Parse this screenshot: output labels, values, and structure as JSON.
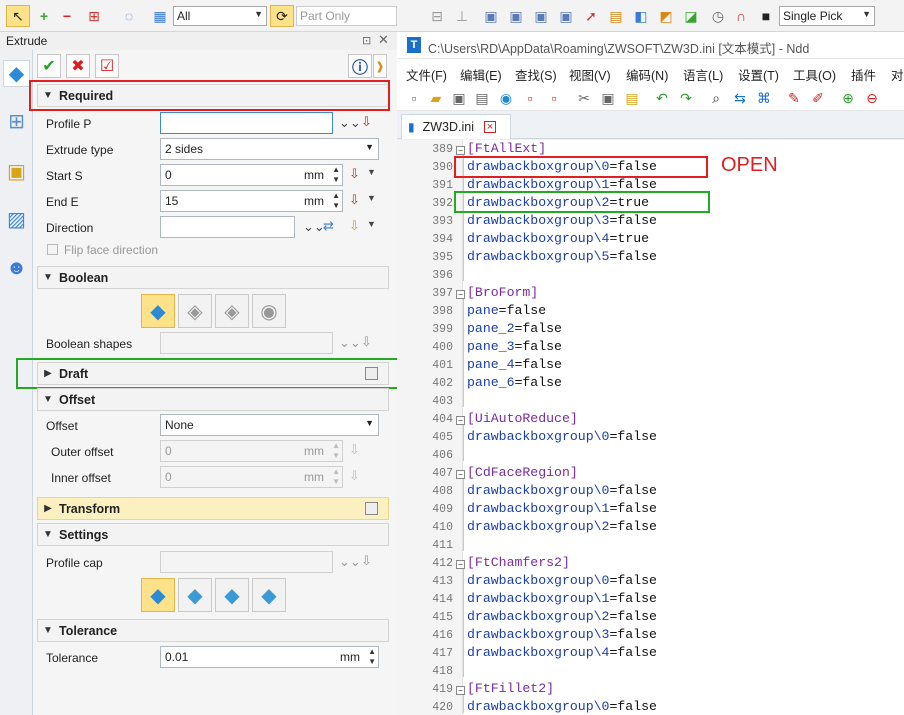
{
  "toolbar": {
    "filter_value": "All",
    "part_only": "Part Only",
    "pick_mode": "Single Pick"
  },
  "panel": {
    "title": "Extrude",
    "sections": {
      "required": "Required",
      "boolean": "Boolean",
      "draft": "Draft",
      "offset": "Offset",
      "transform": "Transform",
      "settings": "Settings",
      "tolerance": "Tolerance"
    },
    "fields": {
      "profile_label": "Profile P",
      "profile_value": "",
      "extrude_type_label": "Extrude type",
      "extrude_type_value": "2 sides",
      "start_label": "Start S",
      "start_value": "0",
      "start_unit": "mm",
      "end_label": "End E",
      "end_value": "15",
      "end_unit": "mm",
      "direction_label": "Direction",
      "direction_value": "",
      "flip_label": "Flip face direction",
      "boolean_shapes_label": "Boolean shapes",
      "offset_label": "Offset",
      "offset_value": "None",
      "outer_offset_label": "Outer offset",
      "outer_offset_value": "0",
      "outer_offset_unit": "mm",
      "inner_offset_label": "Inner offset",
      "inner_offset_value": "0",
      "inner_offset_unit": "mm",
      "profile_cap_label": "Profile cap",
      "tolerance_label": "Tolerance",
      "tolerance_value": "0.01",
      "tolerance_unit": "mm"
    }
  },
  "editor": {
    "window_title": "C:\\Users\\RD\\AppData\\Roaming\\ZWSOFT\\ZW3D.ini [文本模式] - Ndd",
    "menus": [
      "文件(F)",
      "编辑(E)",
      "查找(S)",
      "视图(V)",
      "编码(N)",
      "语言(L)",
      "设置(T)",
      "工具(O)",
      "插件",
      "对"
    ],
    "tab_label": "ZW3D.ini",
    "annotation_open": "OPEN",
    "lines": [
      {
        "n": "389",
        "t": "[FtAllExt]",
        "h": true
      },
      {
        "n": "390",
        "t": "drawbackboxgroup\\0=false"
      },
      {
        "n": "391",
        "t": "drawbackboxgroup\\1=false"
      },
      {
        "n": "392",
        "t": "drawbackboxgroup\\2=true"
      },
      {
        "n": "393",
        "t": "drawbackboxgroup\\3=false"
      },
      {
        "n": "394",
        "t": "drawbackboxgroup\\4=true"
      },
      {
        "n": "395",
        "t": "drawbackboxgroup\\5=false"
      },
      {
        "n": "396",
        "t": ""
      },
      {
        "n": "397",
        "t": "[BroForm]",
        "h": true
      },
      {
        "n": "398",
        "t": "pane=false"
      },
      {
        "n": "399",
        "t": "pane_2=false"
      },
      {
        "n": "400",
        "t": "pane_3=false"
      },
      {
        "n": "401",
        "t": "pane_4=false"
      },
      {
        "n": "402",
        "t": "pane_6=false"
      },
      {
        "n": "403",
        "t": ""
      },
      {
        "n": "404",
        "t": "[UiAutoReduce]",
        "h": true
      },
      {
        "n": "405",
        "t": "drawbackboxgroup\\0=false"
      },
      {
        "n": "406",
        "t": ""
      },
      {
        "n": "407",
        "t": "[CdFaceRegion]",
        "h": true
      },
      {
        "n": "408",
        "t": "drawbackboxgroup\\0=false"
      },
      {
        "n": "409",
        "t": "drawbackboxgroup\\1=false"
      },
      {
        "n": "410",
        "t": "drawbackboxgroup\\2=false"
      },
      {
        "n": "411",
        "t": ""
      },
      {
        "n": "412",
        "t": "[FtChamfers2]",
        "h": true
      },
      {
        "n": "413",
        "t": "drawbackboxgroup\\0=false"
      },
      {
        "n": "414",
        "t": "drawbackboxgroup\\1=false"
      },
      {
        "n": "415",
        "t": "drawbackboxgroup\\2=false"
      },
      {
        "n": "416",
        "t": "drawbackboxgroup\\3=false"
      },
      {
        "n": "417",
        "t": "drawbackboxgroup\\4=false"
      },
      {
        "n": "418",
        "t": ""
      },
      {
        "n": "419",
        "t": "[FtFillet2]",
        "h": true
      },
      {
        "n": "420",
        "t": "drawbackboxgroup\\0=false"
      }
    ]
  }
}
